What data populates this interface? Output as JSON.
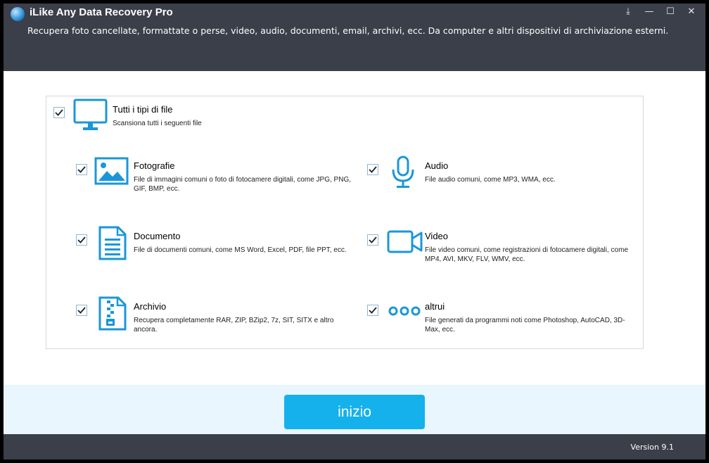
{
  "app": {
    "title": "iLike Any Data Recovery Pro",
    "subtitle": "Recupera foto cancellate, formattate o perse, video, audio, documenti, email, archivi, ecc. Da computer e altri dispositivi di archiviazione esterni.",
    "version": "Version 9.1"
  },
  "colors": {
    "accent": "#14b1ec",
    "icon": "#1a97d8",
    "header_bg": "#3b3f49",
    "bottom_bg": "#eaf6fd"
  },
  "window_controls": [
    {
      "name": "download-icon",
      "glyph": "⤓"
    },
    {
      "name": "minimize-icon",
      "glyph": "—"
    },
    {
      "name": "maximize-icon",
      "glyph": "☐"
    },
    {
      "name": "close-icon",
      "glyph": "✕"
    }
  ],
  "all_types": {
    "checked": true,
    "title": "Tutti i tipi di file",
    "desc": "Scansiona tutti i seguenti file",
    "icon": "monitor-icon"
  },
  "file_types": {
    "photos": {
      "checked": true,
      "icon": "image-icon",
      "title": "Fotografie",
      "desc": "File di immagini comuni o foto di fotocamere digitali, come JPG, PNG, GIF, BMP, ecc."
    },
    "audio": {
      "checked": true,
      "icon": "microphone-icon",
      "title": "Audio",
      "desc": "File audio comuni, come MP3, WMA, ecc."
    },
    "document": {
      "checked": true,
      "icon": "document-icon",
      "title": "Documento",
      "desc": "File di documenti comuni, come MS Word, Excel, PDF, file PPT, ecc."
    },
    "video": {
      "checked": true,
      "icon": "video-camera-icon",
      "title": "Video",
      "desc": "File video comuni, come registrazioni di fotocamere digitali, come MP4, AVI, MKV, FLV, WMV, ecc."
    },
    "archive": {
      "checked": true,
      "icon": "archive-zip-icon",
      "title": "Archivio",
      "desc": "Recupera completamente RAR, ZIP, BZip2, 7z, SIT, SITX e altro ancora."
    },
    "other": {
      "checked": true,
      "icon": "more-dots-icon",
      "title": "altrui",
      "desc": "File generati da programmi noti come Photoshop, AutoCAD, 3D-Max, ecc."
    }
  },
  "start_button": {
    "label": "inizio"
  }
}
